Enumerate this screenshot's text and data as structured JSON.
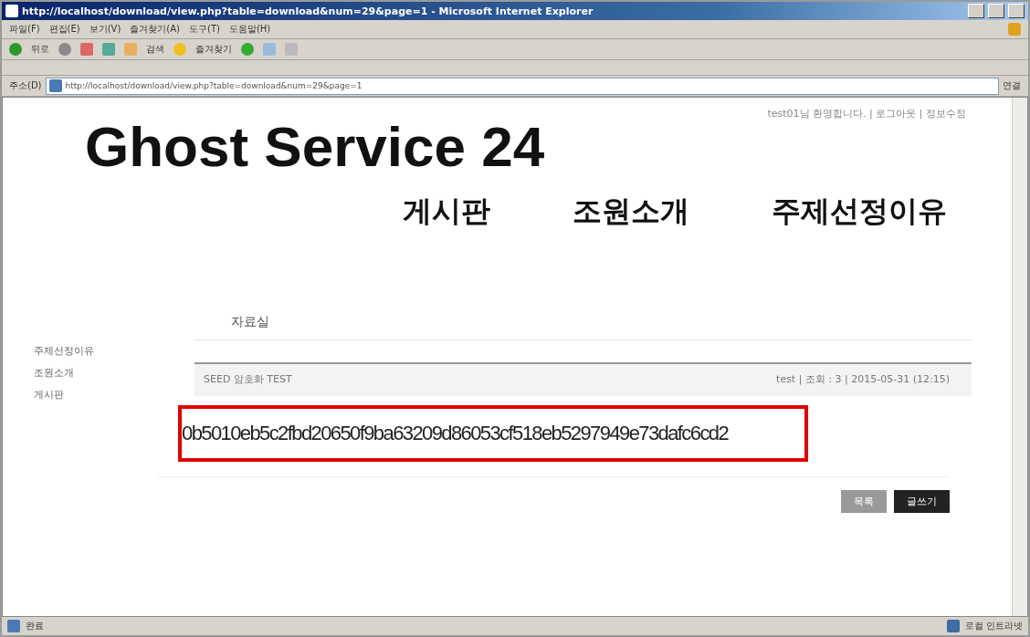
{
  "window": {
    "title": "http://localhost/download/view.php?table=download&num=29&page=1 - Microsoft Internet Explorer"
  },
  "menu": [
    "파일(F)",
    "편집(E)",
    "보기(V)",
    "즐겨찾기(A)",
    "도구(T)",
    "도움말(H)"
  ],
  "toolbar": {
    "back": "뒤로",
    "search": "검색",
    "favorites": "즐겨찾기"
  },
  "address_bar": {
    "label": "주소(D)",
    "value": "http://localhost/download/view.php?table=download&num=29&page=1",
    "go": "연결"
  },
  "page": {
    "user_links": "test01님 환영합니다. | 로그아웃 | 정보수정",
    "logo": "Ghost Service 24",
    "nav": [
      "게시판",
      "조원소개",
      "주제선정이유"
    ],
    "sidebar": [
      "주제선정이유",
      "조원소개",
      "게시판"
    ],
    "section_title": "자료실",
    "post": {
      "title": "SEED 암호화 TEST",
      "meta": "test | 조회 : 3 | 2015-05-31 (12:15)",
      "body": "0b5010eb5c2fbd20650f9ba63209d86053cf518eb5297949e73dafc6cd2"
    },
    "buttons": [
      {
        "label": "목록",
        "kind": "secondary"
      },
      {
        "label": "글쓰기",
        "kind": "primary"
      }
    ]
  },
  "status_bar": {
    "status": "완료",
    "zone": "로컬 인트라넷"
  }
}
